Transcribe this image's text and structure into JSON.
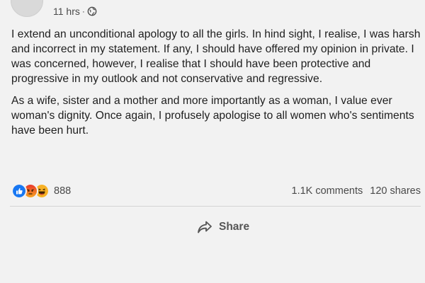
{
  "post": {
    "timestamp": "11 hrs",
    "separator": "·",
    "paragraphs": [
      "I extend an unconditional apology to all the girls. In hind sight, I realise, I was harsh and incorrect in my statement. If any, I should have offered my opinion in private. I was concerned, however, I realise that I should have been protective and progressive in my outlook and not conservative and regressive.",
      "As a wife, sister and a mother and more importantly as a woman, I value ever woman's dignity. Once again, I profusely apologise to all women who's sentiments have been hurt."
    ],
    "privacy_icon": "globe-icon"
  },
  "reactions": {
    "icons": [
      "like-icon",
      "angry-icon",
      "haha-icon"
    ],
    "count": "888",
    "colors": {
      "like": "#1877f2",
      "angry": "#e9710f",
      "haha": "#f7b125"
    }
  },
  "stats": {
    "comments": "1.1K comments",
    "shares": "120 shares"
  },
  "actions": {
    "share_label": "Share"
  }
}
